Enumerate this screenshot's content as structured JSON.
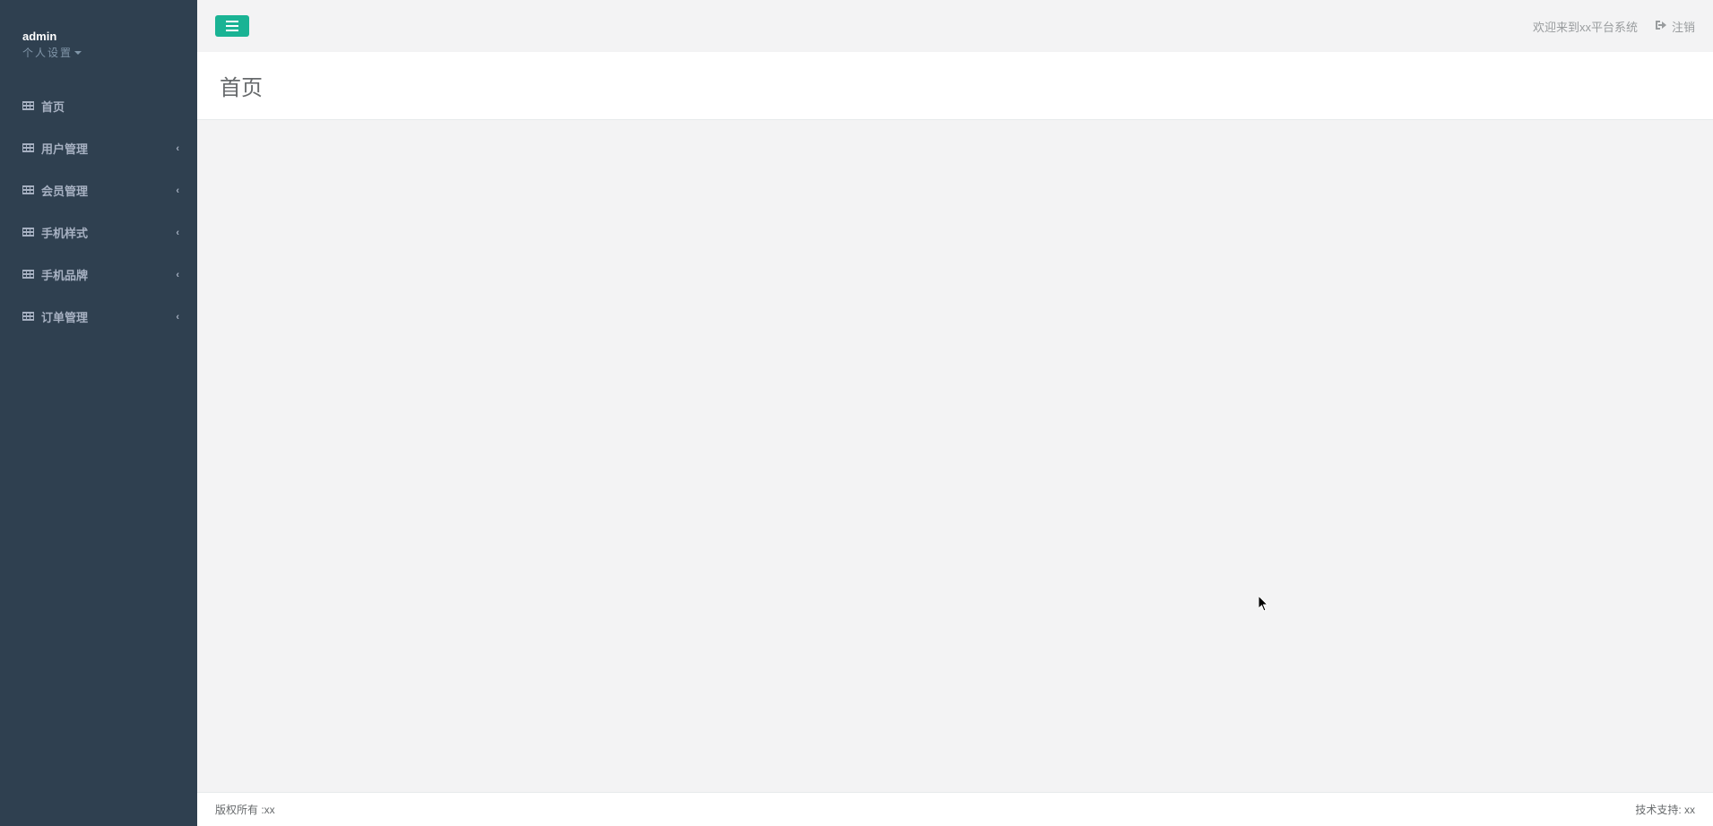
{
  "user": {
    "name": "admin",
    "settings_label": "个人设置"
  },
  "sidebar": {
    "items": [
      {
        "label": "首页",
        "expandable": false
      },
      {
        "label": "用户管理",
        "expandable": true
      },
      {
        "label": "会员管理",
        "expandable": true
      },
      {
        "label": "手机样式",
        "expandable": true
      },
      {
        "label": "手机品牌",
        "expandable": true
      },
      {
        "label": "订单管理",
        "expandable": true
      }
    ]
  },
  "topbar": {
    "welcome": "欢迎来到xx平台系统",
    "logout": "注销"
  },
  "page": {
    "title": "首页"
  },
  "footer": {
    "copyright": "版权所有 :xx",
    "support": "技术支持: xx"
  }
}
